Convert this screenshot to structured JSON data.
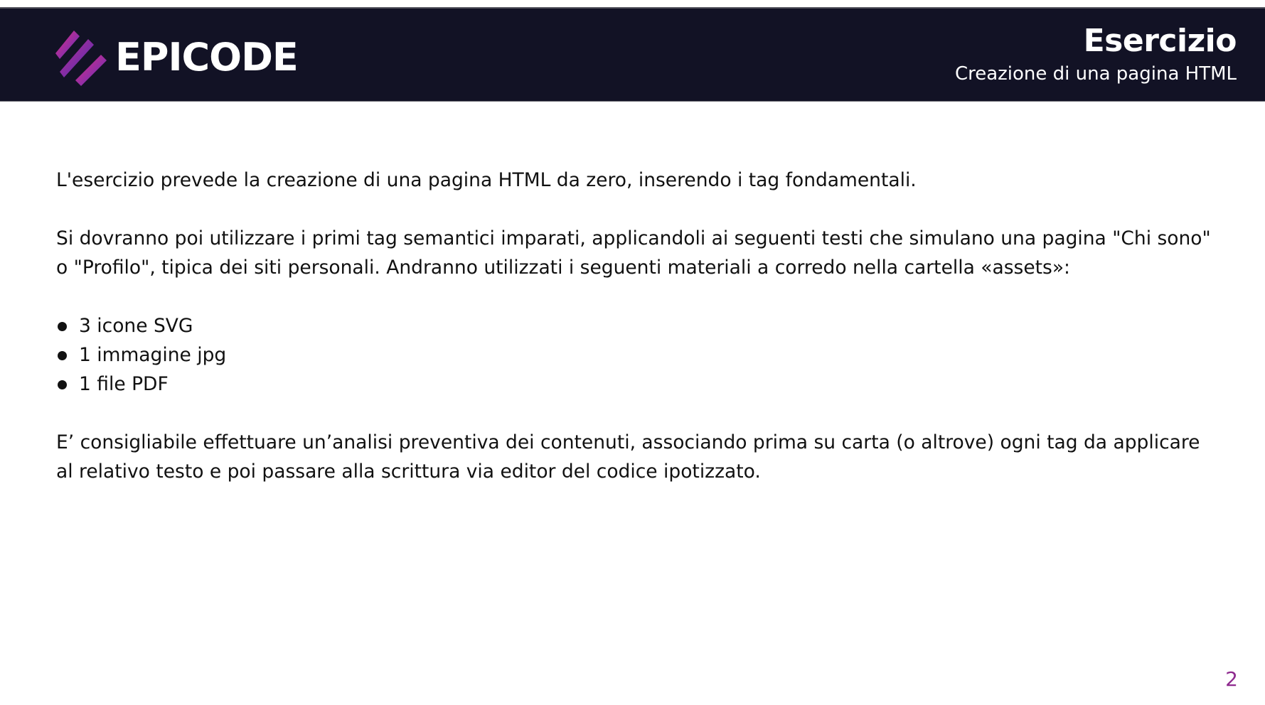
{
  "header": {
    "logo_text": "EPICODE",
    "logo_icon": "epicode-stripes-logo",
    "title": "Esercizio",
    "subtitle": "Creazione di una pagina HTML"
  },
  "content": {
    "paragraph_1": "L'esercizio prevede la creazione di una pagina HTML da zero, inserendo i tag fondamentali.",
    "paragraph_2": "Si dovranno poi utilizzare i primi tag semantici imparati, applicandoli ai seguenti testi che simulano una pagina \"Chi sono\" o \"Profilo\", tipica dei siti personali. Andranno utilizzati i seguenti materiali a corredo nella cartella «assets»:",
    "bullets": [
      "3 icone SVG",
      "1 immagine jpg",
      "1 file PDF"
    ],
    "paragraph_3": "E’ consigliabile effettuare un’analisi preventiva dei contenuti, associando prima su carta (o altrove) ogni tag da applicare al relativo testo e poi passare alla scrittura via editor del codice ipotizzato."
  },
  "page_number": "2",
  "colors": {
    "header_bg": "#121225",
    "accent": "#8e2a8e",
    "logo_gradient_start": "#e0317d",
    "logo_gradient_end": "#5b2bc4"
  }
}
